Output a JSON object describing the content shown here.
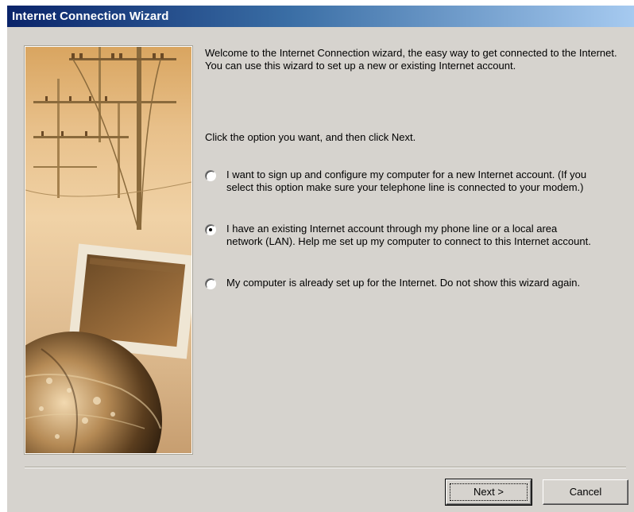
{
  "window": {
    "title": "Internet Connection Wizard"
  },
  "content": {
    "welcome_text": "Welcome to the Internet Connection wizard, the easy way to get connected to the Internet. You can use this wizard to set up a new or existing Internet account.",
    "instruction_text": "Click the option you want, and then click Next."
  },
  "options": [
    {
      "label": "I want to sign up and configure my computer for a new Internet account. (If you select this option make sure your telephone line is connected to your modem.)",
      "selected": false
    },
    {
      "label": "I have an existing Internet account through my phone line or a local area network (LAN). Help me set up my computer to connect to this Internet account.",
      "selected": true
    },
    {
      "label": "My computer is already set up for the Internet. Do not show this wizard again.",
      "selected": false
    }
  ],
  "buttons": {
    "next_label": "Next >",
    "cancel_label": "Cancel"
  },
  "colors": {
    "titlebar_start": "#0a246a",
    "titlebar_end": "#a6caf0",
    "dialog_face": "#d6d3ce"
  }
}
